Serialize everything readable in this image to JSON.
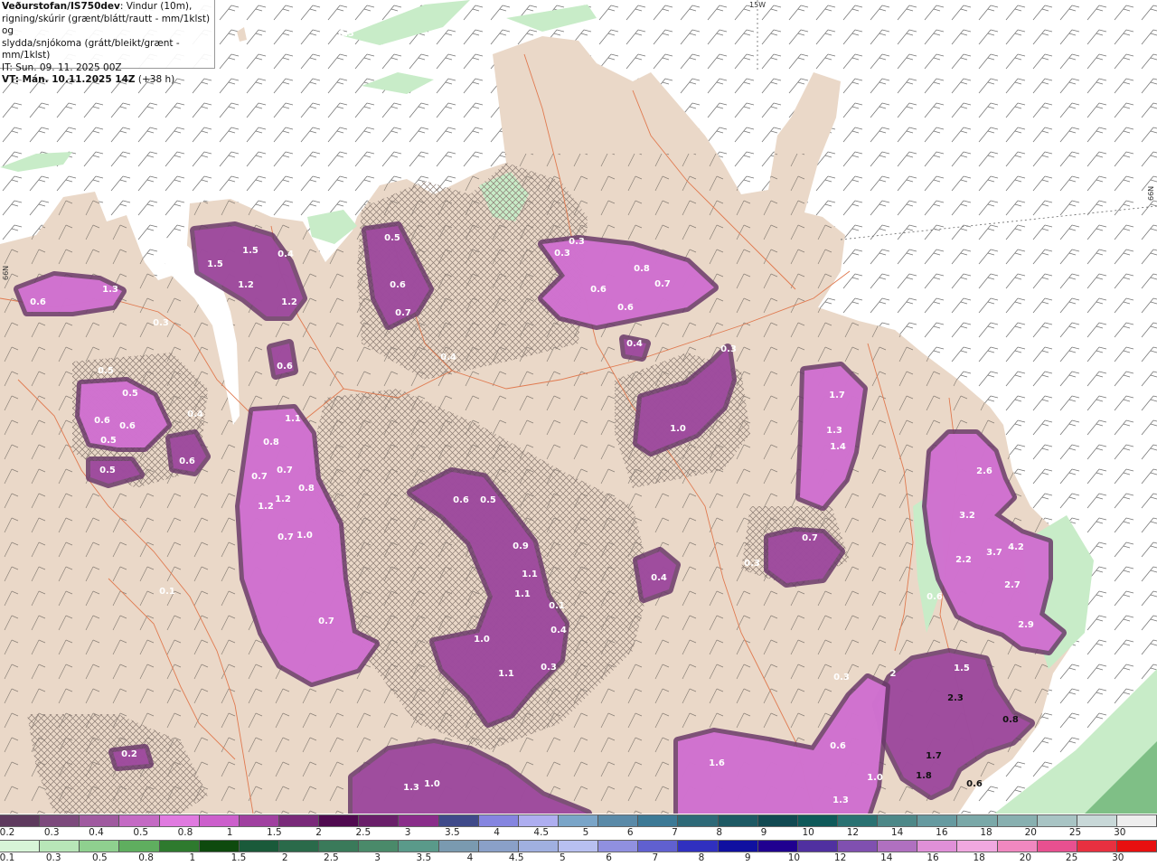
{
  "title_box": {
    "line1_bold": "Veðurstofan/IS750dev",
    "line1_rest": ": Vindur (10m),",
    "line2": "rigning/skúrir (grænt/blátt/rautt - mm/1klst) og",
    "line3": "slydda/snjókoma (grátt/bleikt/grænt - mm/1klst)",
    "line4": "IT: Sun. 09. 11. 2025 00Z",
    "line5_bold": "VT: Mán. 10.11.2025 14Z",
    "line5_rest": " (+38 h)"
  },
  "coord_labels": {
    "lon_15w": "15W",
    "lat_66n_right": "66N",
    "lat_66n_left": "66N"
  },
  "colors": {
    "sea": "#ffffff",
    "land": "#ead8c8",
    "roads": "#e07a50",
    "snow_dark": "#6a3a6a",
    "snow_mid": "#a64ea6",
    "snow_bright": "#e07ae0",
    "rain_light": "#c8ecc8"
  },
  "value_labels": [
    {
      "v": "0.3"
    },
    {
      "v": "0.3"
    },
    {
      "v": "1.5"
    },
    {
      "v": "1.5"
    },
    {
      "v": "0.4"
    },
    {
      "v": "1.2"
    },
    {
      "v": "1.2"
    },
    {
      "v": "1.3"
    },
    {
      "v": "0.6"
    },
    {
      "v": "0.5"
    },
    {
      "v": "0.6"
    },
    {
      "v": "0.7"
    },
    {
      "v": "0.3"
    },
    {
      "v": "0.3"
    },
    {
      "v": "0.8"
    },
    {
      "v": "0.6"
    },
    {
      "v": "0.7"
    },
    {
      "v": "0.6"
    },
    {
      "v": "0.4"
    },
    {
      "v": "0.3"
    },
    {
      "v": "0.4"
    },
    {
      "v": "0.6"
    },
    {
      "v": "0.5"
    },
    {
      "v": "0.5"
    },
    {
      "v": "0.6"
    },
    {
      "v": "0.6"
    },
    {
      "v": "0.5"
    },
    {
      "v": "0.4"
    },
    {
      "v": "0.6"
    },
    {
      "v": "0.5"
    },
    {
      "v": "1.1"
    },
    {
      "v": "0.8"
    },
    {
      "v": "0.7"
    },
    {
      "v": "0.7"
    },
    {
      "v": "0.8"
    },
    {
      "v": "1.2"
    },
    {
      "v": "1.2"
    },
    {
      "v": "0.7"
    },
    {
      "v": "1.0"
    },
    {
      "v": "0.7"
    },
    {
      "v": "0.6"
    },
    {
      "v": "0.5"
    },
    {
      "v": "0.9"
    },
    {
      "v": "1.1"
    },
    {
      "v": "1.1"
    },
    {
      "v": "0.1"
    },
    {
      "v": "0.4"
    },
    {
      "v": "1.0"
    },
    {
      "v": "1.1"
    },
    {
      "v": "0.3"
    },
    {
      "v": "1.7"
    },
    {
      "v": "1.3"
    },
    {
      "v": "1.4"
    },
    {
      "v": "1.0"
    },
    {
      "v": "0.7"
    },
    {
      "v": "0.3"
    },
    {
      "v": "0.4"
    },
    {
      "v": "2.6"
    },
    {
      "v": "3.2"
    },
    {
      "v": "3.7"
    },
    {
      "v": "4.2"
    },
    {
      "v": "2.2"
    },
    {
      "v": "2.7"
    },
    {
      "v": "0.6"
    },
    {
      "v": "2.9"
    },
    {
      "v": "1.5"
    },
    {
      "v": "2.3"
    },
    {
      "v": "0.8"
    },
    {
      "v": "1.7"
    },
    {
      "v": "1.8"
    },
    {
      "v": "0.6"
    },
    {
      "v": "0.3"
    },
    {
      "v": "0.6"
    },
    {
      "v": "1.0"
    },
    {
      "v": "1.3"
    },
    {
      "v": "1.6"
    },
    {
      "v": "1.3"
    },
    {
      "v": "1.0"
    },
    {
      "v": "0.2"
    },
    {
      "v": "0.1"
    },
    {
      "v": "2"
    }
  ],
  "legend_snow": {
    "colors": [
      "#5e3a5e",
      "#7d4a7d",
      "#a05aa0",
      "#c46ac4",
      "#e07ae0",
      "#cc5fcc",
      "#a040a0",
      "#7a2a7a",
      "#500a50",
      "#6a1f6a",
      "#8a2d8a",
      "#3f4a8a",
      "#8585e0",
      "#aeaef0",
      "#7aa5c8",
      "#5a8aa8",
      "#3d7a96",
      "#2e6a78",
      "#1e5a64",
      "#124a52",
      "#0f5a5a",
      "#2a7272",
      "#4d8888",
      "#669aa0",
      "#7aa8a8",
      "#88b0b0",
      "#a8c4c4",
      "#c8d8d8",
      "#eeeeee"
    ],
    "ticks": [
      "0.2",
      "0.3",
      "0.4",
      "0.5",
      "0.8",
      "1",
      "1.5",
      "2",
      "2.5",
      "3",
      "3.5",
      "4",
      "4.5",
      "5",
      "6",
      "7",
      "8",
      "9",
      "10",
      "12",
      "14",
      "16",
      "18",
      "20",
      "25",
      "30"
    ]
  },
  "legend_rain": {
    "colors": [
      "#d8f5d8",
      "#b8e6b8",
      "#8fd08f",
      "#5fae5f",
      "#2e7a2e",
      "#0e4a0e",
      "#1a5a3a",
      "#2a6a4a",
      "#3a7a5a",
      "#4a8a6a",
      "#5a9a8a",
      "#7a9ab0",
      "#8aa0c8",
      "#a0b0e0",
      "#b8c0f0",
      "#9090e0",
      "#6060d0",
      "#3030c0",
      "#1010a0",
      "#200090",
      "#5030a0",
      "#8050b0",
      "#b070c0",
      "#e090d8",
      "#f0a8e0",
      "#f088c0",
      "#e85090",
      "#e83040",
      "#e81010"
    ],
    "ticks": [
      "0.1",
      "0.3",
      "0.5",
      "0.8",
      "1",
      "1.5",
      "2",
      "2.5",
      "3",
      "3.5",
      "4",
      "4.5",
      "5",
      "6",
      "7",
      "8",
      "9",
      "10",
      "12",
      "14",
      "16",
      "18",
      "20",
      "25",
      "30"
    ]
  }
}
